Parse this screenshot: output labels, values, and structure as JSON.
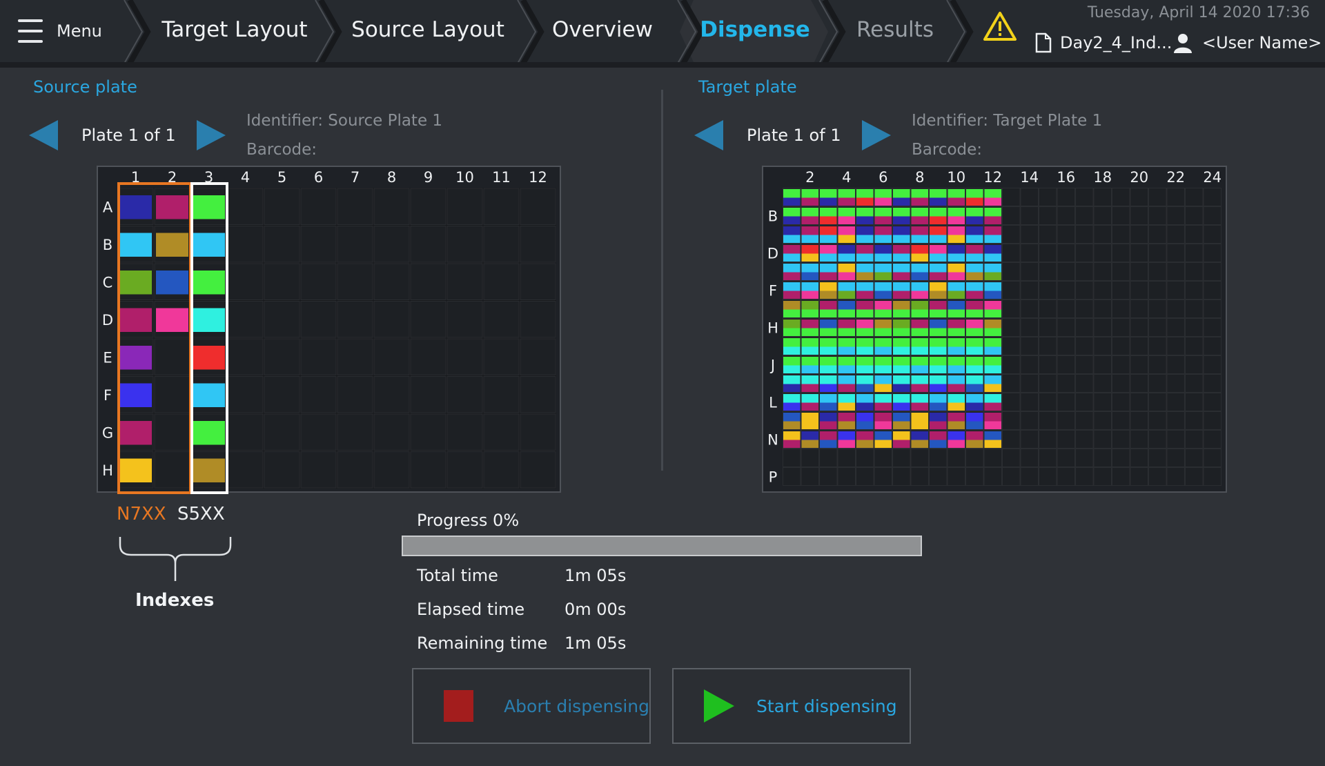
{
  "menu": {
    "label": "Menu"
  },
  "tabs": [
    {
      "label": "Target Layout",
      "state": "normal"
    },
    {
      "label": "Source Layout",
      "state": "normal"
    },
    {
      "label": "Overview",
      "state": "normal"
    },
    {
      "label": "Dispense",
      "state": "active"
    },
    {
      "label": "Results",
      "state": "dim"
    }
  ],
  "status": {
    "datetime": "Tuesday, April 14 2020  17:36",
    "file_name": "Day2_4_Ind...",
    "user_name": "<User Name>",
    "warning_icon": "warning-triangle-icon"
  },
  "source": {
    "title": "Source plate",
    "plate_count": "Plate 1 of 1",
    "identifier": "Identifier: Source Plate 1",
    "barcode": "Barcode:",
    "col_labels": [
      "1",
      "2",
      "3",
      "4",
      "5",
      "6",
      "7",
      "8",
      "9",
      "10",
      "11",
      "12"
    ],
    "row_labels": [
      "A",
      "B",
      "C",
      "D",
      "E",
      "F",
      "G",
      "H"
    ],
    "wells": [
      [
        "#2a2aa8",
        "#b01f6a",
        "#44ef3f",
        "",
        "",
        "",
        "",
        "",
        "",
        "",
        "",
        ""
      ],
      [
        "#30c6f4",
        "#b08c26",
        "#30c6f4",
        "",
        "",
        "",
        "",
        "",
        "",
        "",
        "",
        ""
      ],
      [
        "#6aab22",
        "#2457c0",
        "#44ef3f",
        "",
        "",
        "",
        "",
        "",
        "",
        "",
        "",
        ""
      ],
      [
        "#b01f6a",
        "#f0389a",
        "#2ff0e0",
        "",
        "",
        "",
        "",
        "",
        "",
        "",
        "",
        ""
      ],
      [
        "#8a28b8",
        "",
        "#ef2d2d",
        "",
        "",
        "",
        "",
        "",
        "",
        "",
        "",
        ""
      ],
      [
        "#3a32ee",
        "",
        "#30c6f4",
        "",
        "",
        "",
        "",
        "",
        "",
        "",
        "",
        ""
      ],
      [
        "#b01f6a",
        "",
        "#44ef3f",
        "",
        "",
        "",
        "",
        "",
        "",
        "",
        "",
        ""
      ],
      [
        "#f4c21c",
        "",
        "#b08c26",
        "",
        "",
        "",
        "",
        "",
        "",
        "",
        "",
        ""
      ]
    ],
    "index_groups": [
      {
        "name": "N7XX",
        "color": "#e87722",
        "columns": [
          1,
          2
        ]
      },
      {
        "name": "S5XX",
        "color": "#ffffff",
        "columns": [
          3
        ]
      }
    ],
    "indexes_label": "Indexes"
  },
  "target": {
    "title": "Target plate",
    "plate_count": "Plate 1 of 1",
    "identifier": "Identifier: Target Plate 1",
    "barcode": "Barcode:",
    "columns": 24,
    "rows": 16,
    "col_labels": [
      "2",
      "4",
      "6",
      "8",
      "10",
      "12",
      "14",
      "16",
      "18",
      "20",
      "22",
      "24"
    ],
    "row_labels": [
      "B",
      "D",
      "F",
      "H",
      "J",
      "L",
      "N",
      "P"
    ],
    "filled_columns": 12,
    "filled_rows": 8,
    "row_colors": [
      [
        "#44ef3f",
        "#44ef3f",
        "#44ef3f",
        "#44ef3f",
        "#44ef3f",
        "#44ef3f"
      ],
      [
        "#2a2aa8",
        "#b01f6a",
        "#2a2aa8",
        "#b01f6a",
        "#ef2d2d",
        "#f0389a"
      ],
      [
        "#30c6f4",
        "#f4c21c",
        "#30c6f4",
        "#30c6f4",
        "#30c6f4",
        "#30c6f4"
      ],
      [
        "#b08c26",
        "#6aab22",
        "#b01f6a",
        "#2457c0",
        "#b01f6a",
        "#f0389a"
      ],
      [
        "#44ef3f",
        "#44ef3f",
        "#44ef3f",
        "#44ef3f",
        "#44ef3f",
        "#44ef3f"
      ],
      [
        "#2ff0e0",
        "#30c6f4",
        "#2ff0e0",
        "#30c6f4",
        "#2ff0e0",
        "#2ff0e0"
      ],
      [
        "#2457c0",
        "#f4c21c",
        "#2a2aa8",
        "#b01f6a",
        "#3a32ee",
        "#b01f6a"
      ],
      [
        "#b08c26",
        "#f4c21c",
        "#b01f6a",
        "#b08c26",
        "#2457c0",
        "#f0389a"
      ]
    ]
  },
  "progress": {
    "label": "Progress 0%",
    "percent": 0,
    "total_label": "Total time",
    "total_value": "1m 05s",
    "elapsed_label": "Elapsed time",
    "elapsed_value": "0m 00s",
    "remaining_label": "Remaining time",
    "remaining_value": "1m 05s"
  },
  "actions": {
    "abort_label": "Abort dispensing",
    "start_label": "Start dispensing"
  }
}
